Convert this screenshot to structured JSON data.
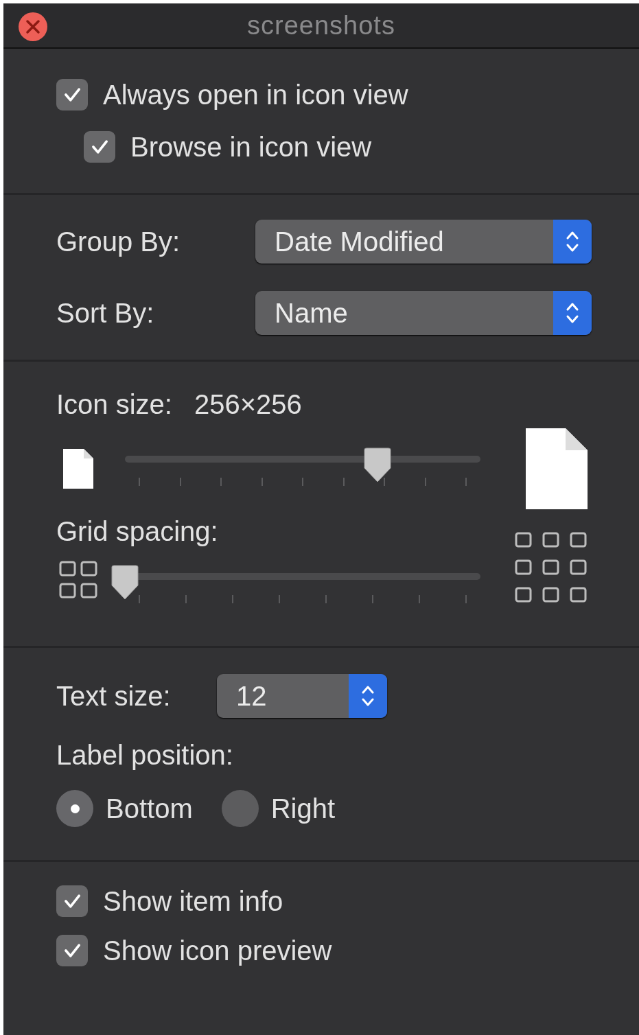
{
  "window": {
    "title": "screenshots"
  },
  "view_options": [
    {
      "label": "Always open in icon view",
      "checked": true,
      "children": [
        {
          "label": "Browse in icon view",
          "checked": true
        }
      ]
    }
  ],
  "popups": [
    {
      "label": "Group By:",
      "value": "Date Modified"
    },
    {
      "label": "Sort By:",
      "value": "Name"
    }
  ],
  "icon_size": {
    "label": "Icon size:",
    "reading": "256×256",
    "level": 0.71
  },
  "grid_spacing": {
    "label": "Grid spacing:",
    "level": 0
  },
  "text_size": {
    "label": "Text size:",
    "value": "12"
  },
  "label_position": {
    "label": "Label position:",
    "options": [
      {
        "label": "Bottom",
        "selected": true
      },
      {
        "label": "Right",
        "selected": false
      }
    ]
  },
  "show_options": [
    {
      "label": "Show item info",
      "checked": true
    },
    {
      "label": "Show icon preview",
      "checked": true
    }
  ]
}
